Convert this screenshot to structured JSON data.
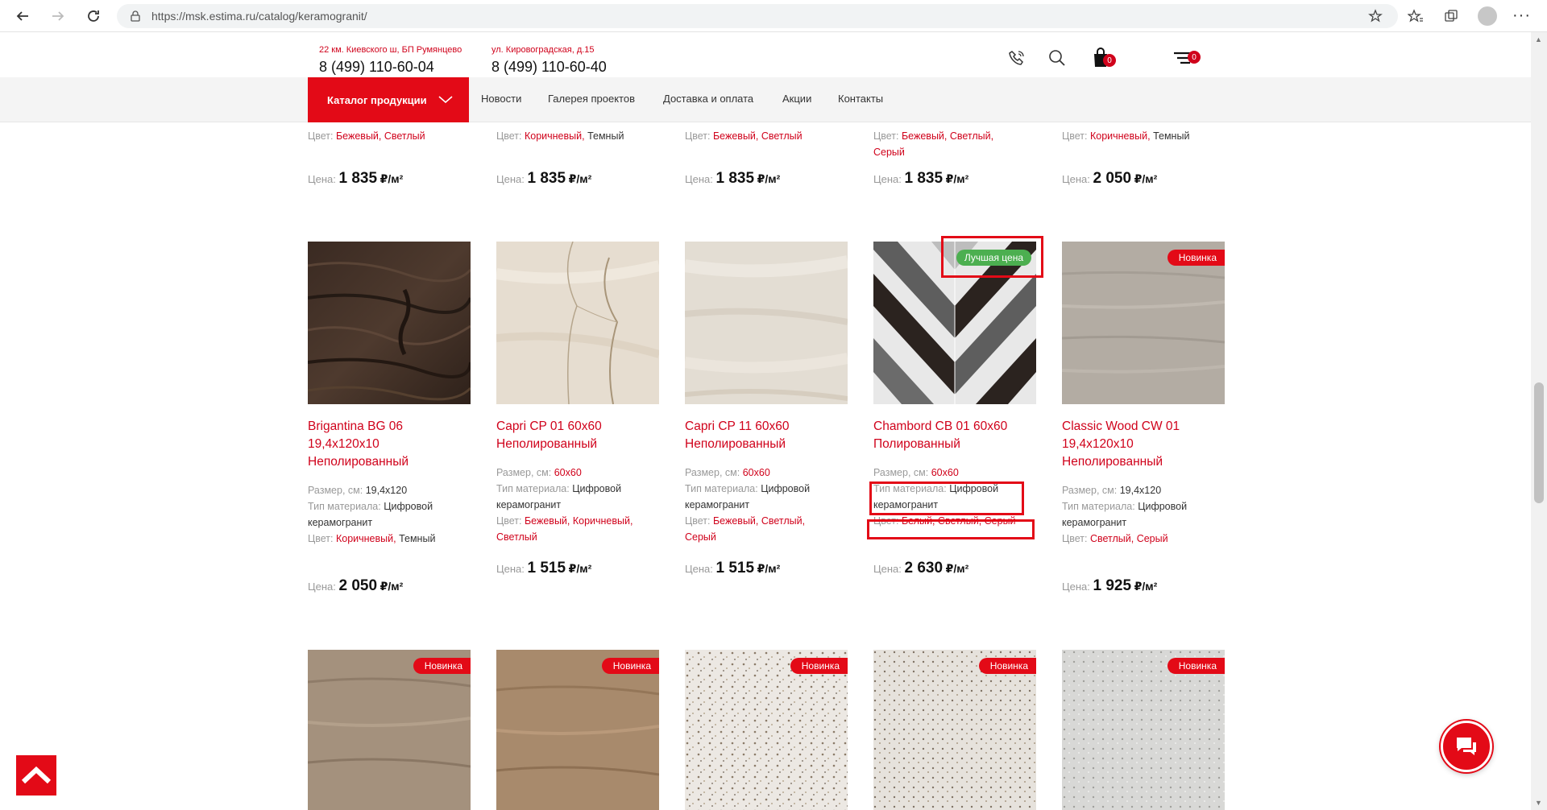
{
  "browser": {
    "url": "https://msk.estima.ru/catalog/keramogranit/"
  },
  "header": {
    "addr1": "22 км. Киевского ш, БП Румянцево",
    "phone1": "8 (499) 110-60-04",
    "addr2": "ул. Кировоградская, д.15",
    "phone2": "8 (499) 110-60-40",
    "cart_count": "0",
    "compare_count": "0"
  },
  "nav": {
    "catalog_label": "Каталог продукции",
    "links": [
      "Новости",
      "Галерея проектов",
      "Доставка и оплата",
      "Акции",
      "Контакты"
    ]
  },
  "labels": {
    "size": "Размер, см:",
    "material": "Тип материала:",
    "color": "Цвет:",
    "price": "Цена:",
    "unit": "₽/м²",
    "truncated": "керамогранит"
  },
  "top_row": [
    {
      "color_red": "Бежевый, Светлый",
      "color_dark": "",
      "price": "1 835"
    },
    {
      "color_red": "Коричневый,",
      "color_dark": "Темный",
      "price": "1 835"
    },
    {
      "color_red": "Бежевый, Светлый",
      "color_dark": "",
      "price": "1 835"
    },
    {
      "color_red": "Бежевый, Светлый,",
      "color_red2": "Серый",
      "color_dark": "",
      "price": "1 835"
    },
    {
      "color_red": "Коричневый,",
      "color_dark": "Темный",
      "price": "2 050"
    }
  ],
  "products": [
    {
      "title": "Brigantina BG 06 19,4x120x10 Неполированный",
      "size": "19,4x120",
      "material_1": "Цифровой",
      "material_2": "керамогранит",
      "color_red": "Коричневый,",
      "color_dark": "Темный",
      "color_2": "",
      "price": "2 050",
      "badge": ""
    },
    {
      "title": "Capri CP 01 60x60 Неполированный",
      "size": "60x60",
      "material_1": "Цифровой",
      "material_2": "керамогранит",
      "color_red": "Бежевый, Коричневый,",
      "color_dark": "",
      "color_2": "Светлый",
      "price": "1 515",
      "badge": ""
    },
    {
      "title": "Capri CP 11 60x60 Неполированный",
      "size": "60x60",
      "material_1": "Цифровой",
      "material_2": "керамогранит",
      "color_red": "Бежевый, Светлый,",
      "color_dark": "",
      "color_2": "Серый",
      "price": "1 515",
      "badge": ""
    },
    {
      "title": "Chambord CB 01 60x60 Полированный",
      "size": "60x60",
      "material_1": "Цифровой",
      "material_2": "керамогранит",
      "color_red": "Белый, Светлый, Серый",
      "color_dark": "",
      "color_2": "",
      "price": "2 630",
      "badge": "Лучшая цена"
    },
    {
      "title": "Classic Wood CW 01 19,4x120x10 Неполированный",
      "size": "19,4x120",
      "material_1": "Цифровой",
      "material_2": "керамогранит",
      "color_red": "Светлый, Серый",
      "color_dark": "",
      "color_2": "",
      "price": "1 925",
      "badge": "Новинка"
    }
  ],
  "bottom_row": [
    {
      "badge": "Новинка"
    },
    {
      "badge": "Новинка"
    },
    {
      "badge": "Новинка"
    },
    {
      "badge": "Новинка"
    },
    {
      "badge": "Новинка"
    }
  ],
  "colors": {
    "accent": "#e30a17",
    "badge_green": "#4caf50",
    "link_red": "#d0021b"
  }
}
